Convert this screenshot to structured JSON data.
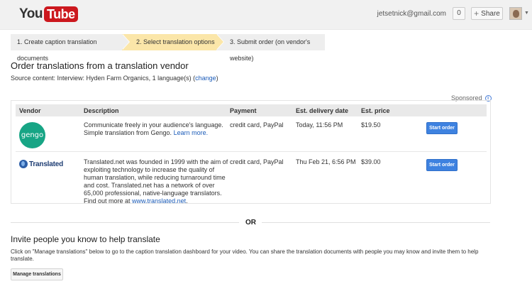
{
  "header": {
    "logo_you": "You",
    "logo_tube": "Tube",
    "email": "jetsetnick@gmail.com",
    "notification_count": "0",
    "share_label": "Share"
  },
  "steps": [
    {
      "label": "1. Create caption translation documents"
    },
    {
      "label": "2. Select translation options"
    },
    {
      "label": "3. Submit order (on vendor's website)"
    }
  ],
  "page_title": "Order translations from a translation vendor",
  "source": {
    "text": "Source content: Interview: Hyden Farm Organics, 1 language(s) (",
    "link": "change",
    "close": ")"
  },
  "sponsored": "Sponsored",
  "table": {
    "headers": {
      "vendor": "Vendor",
      "description": "Description",
      "payment": "Payment",
      "delivery": "Est. delivery date",
      "price": "Est. price"
    },
    "rows": [
      {
        "vendor_logo": "gengo",
        "description": "Communicate freely in your audience's language. Simple translation from Gengo.",
        "description_link": "Learn more.",
        "payment": "credit card, PayPal",
        "delivery": "Today, 11:56 PM",
        "price": "$19.50",
        "button": "Start order"
      },
      {
        "vendor_logo": "Translated",
        "description": "Translated.net was founded in 1999 with the aim of exploiting technology to increase the quality of human translation, while reducing turnaround time and cost. Translated.net has a network of over 65,000 professional, native-language translators. Find out more at",
        "description_link": "www.translated.net",
        "description_end": ".",
        "payment": "credit card, PayPal",
        "delivery": "Thu Feb 21, 6:56 PM",
        "price": "$39.00",
        "button": "Start order"
      }
    ]
  },
  "or_label": "OR",
  "invite": {
    "title": "Invite people you know to help translate",
    "text": "Click on \"Manage translations\" below to go to the caption translation dashboard for your video. You can share the translation documents with people you may know and invite them to help translate.",
    "button": "Manage translations"
  },
  "colors": {
    "youtube_red": "#cc181e",
    "active_step": "#fbe6a9",
    "start_button": "#3e82e0",
    "gengo_green": "#17a585",
    "link": "#1a5bb8"
  }
}
